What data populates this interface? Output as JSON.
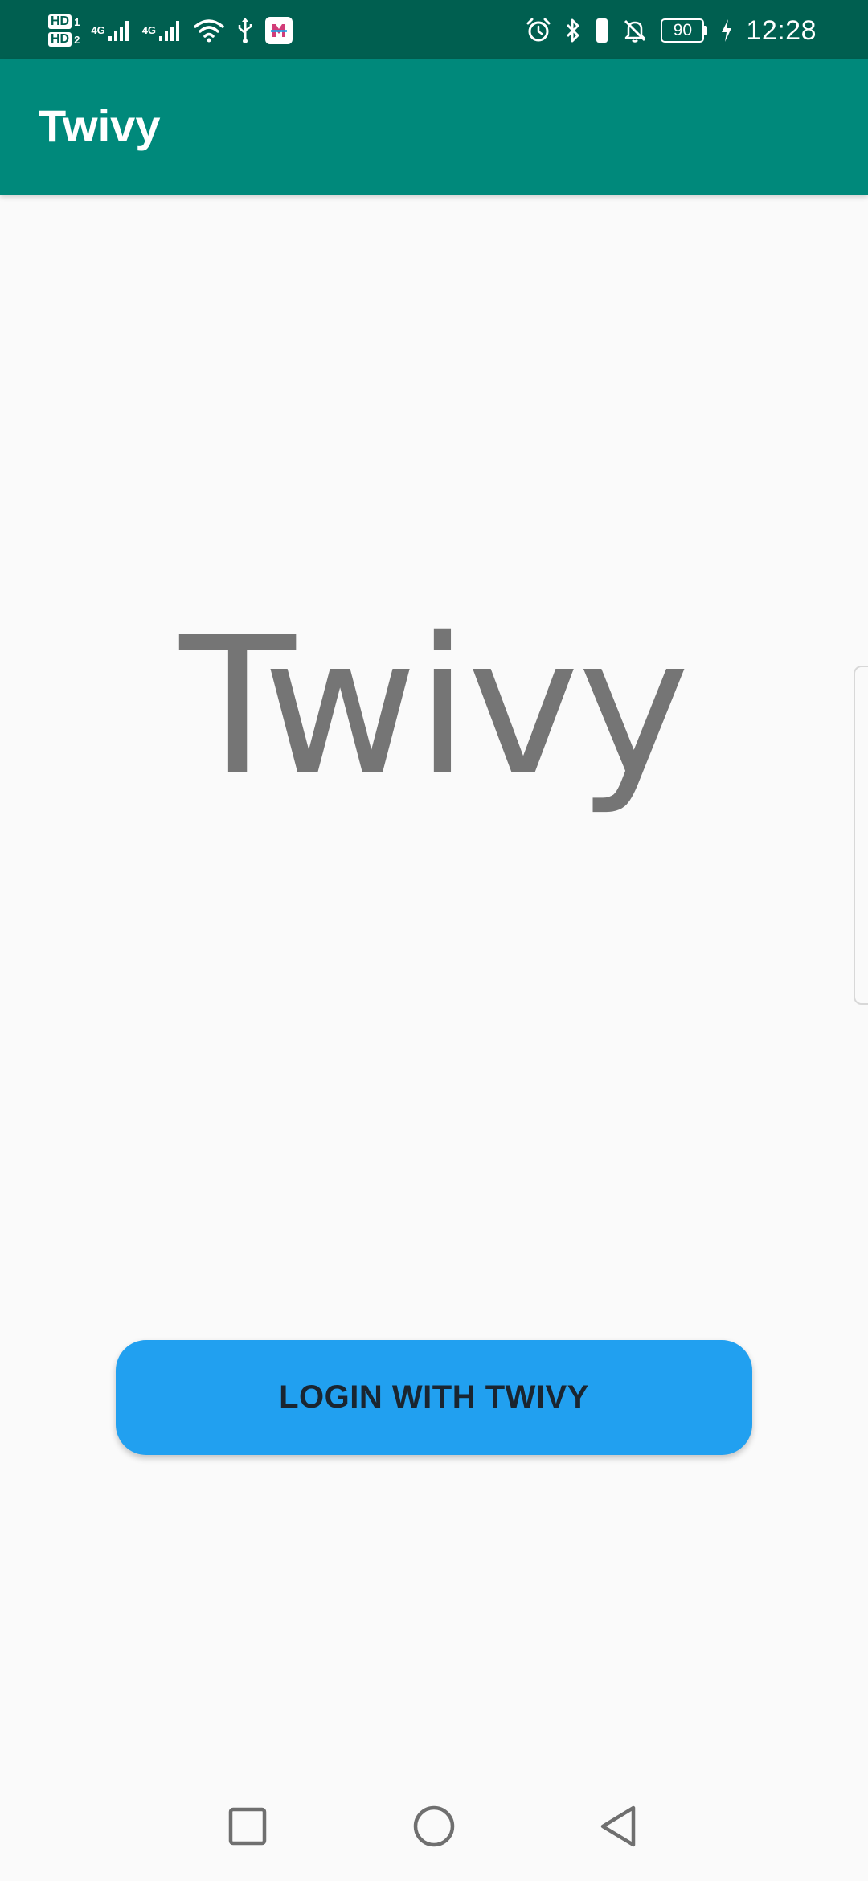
{
  "status_bar": {
    "sim1_badge": "HD",
    "sim1_index": "1",
    "sim2_badge": "HD",
    "sim2_index": "2",
    "network1": "4G",
    "network2": "4G",
    "battery_level": "90",
    "time": "12:28",
    "icons": [
      "signal-icon",
      "wifi-icon",
      "usb-icon",
      "app-notification-icon",
      "alarm-icon",
      "bluetooth-icon",
      "vibrate-icon",
      "mute-bell-icon",
      "battery-icon",
      "charging-icon"
    ]
  },
  "app_bar": {
    "title": "Twivy"
  },
  "main": {
    "logo_text": "Twivy",
    "login_button_label": "LOGIN WITH TWIVY"
  },
  "nav_bar": {
    "icons": [
      "recents-icon",
      "home-icon",
      "back-icon"
    ]
  },
  "colors": {
    "status_bar": "#005f50",
    "app_bar": "#00897b",
    "background": "#fafafa",
    "logo_text": "#757575",
    "button": "#21a0f0",
    "button_text": "#1a2530"
  }
}
